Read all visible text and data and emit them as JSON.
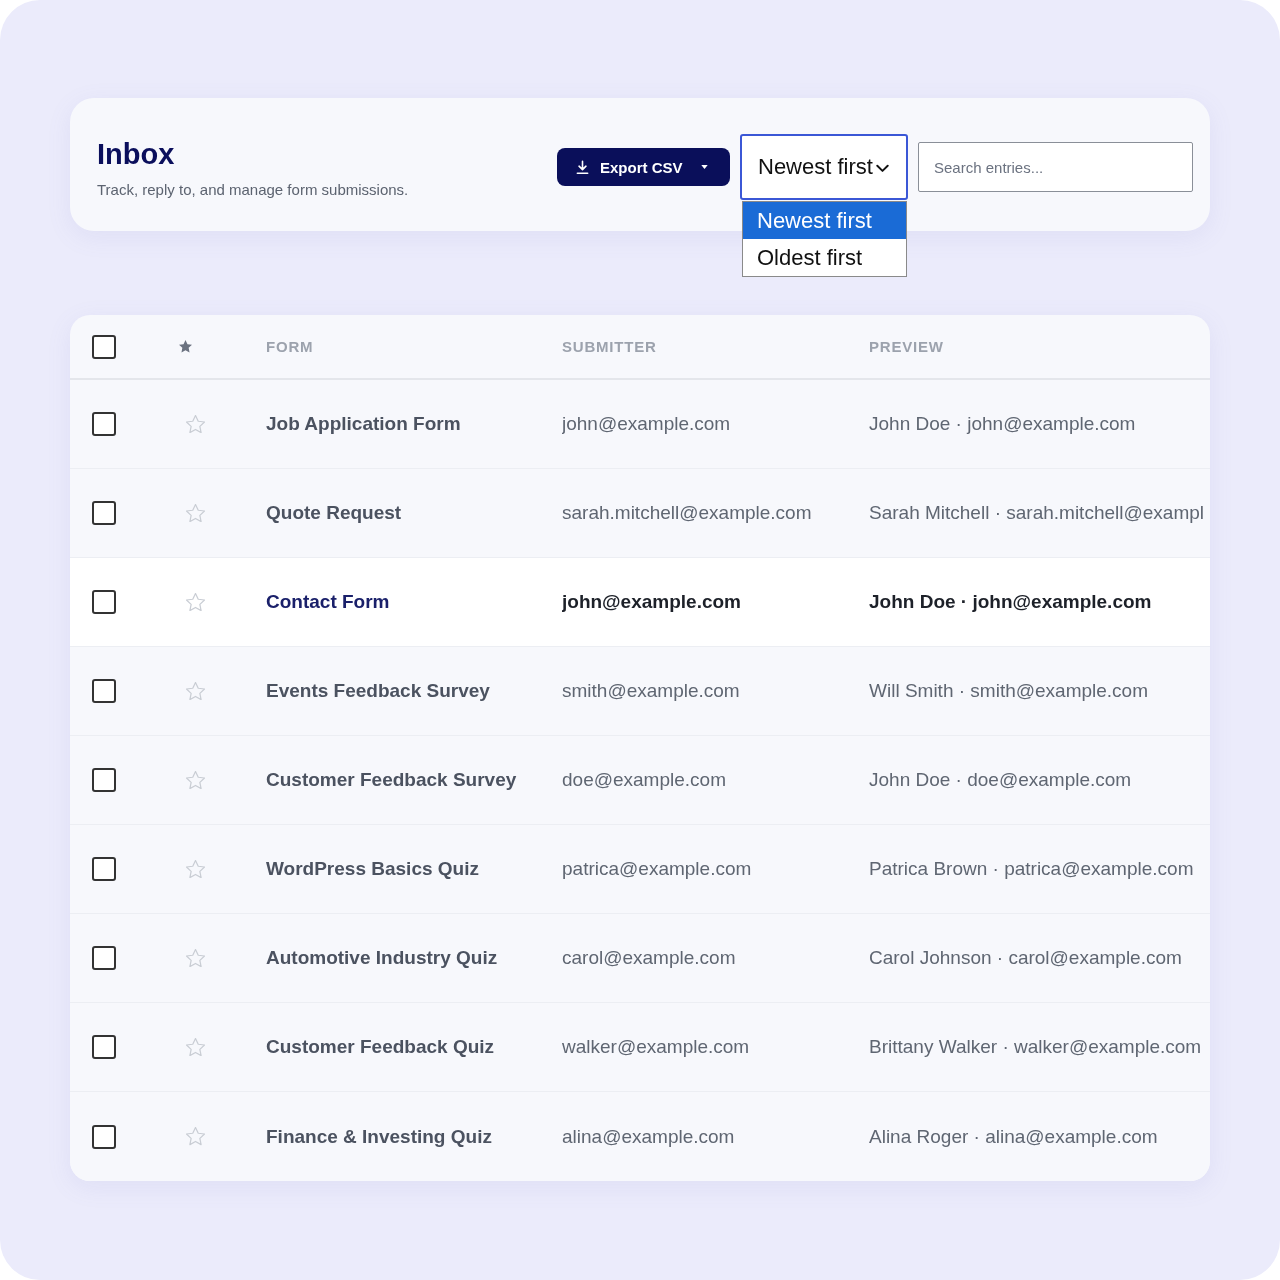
{
  "header": {
    "title": "Inbox",
    "subtitle": "Track, reply to, and manage form submissions."
  },
  "toolbar": {
    "export_button": {
      "label": "Export CSV"
    },
    "sort_select": {
      "value": "Newest first",
      "expanded": true,
      "options": [
        {
          "label": "Newest first",
          "selected": true
        },
        {
          "label": "Oldest first",
          "selected": false
        }
      ]
    },
    "search": {
      "placeholder": "Search entries..."
    }
  },
  "table": {
    "select_all": {
      "checked": false
    },
    "columns": [
      "FORM",
      "SUBMITTER",
      "PREVIEW"
    ],
    "rows": [
      {
        "form": "Job Application Form",
        "submitter": "john@example.com",
        "preview": "John Doe · john@example.com",
        "checked": false,
        "starred": false,
        "unread": false
      },
      {
        "form": "Quote Request",
        "submitter": "sarah.mitchell@example.com",
        "preview": "Sarah Mitchell · sarah.mitchell@exampl",
        "checked": false,
        "starred": false,
        "unread": false
      },
      {
        "form": "Contact Form",
        "submitter": "john@example.com",
        "preview": "John Doe · john@example.com",
        "checked": false,
        "starred": false,
        "unread": true
      },
      {
        "form": "Events Feedback Survey",
        "submitter": "smith@example.com",
        "preview": "Will Smith · smith@example.com",
        "checked": false,
        "starred": false,
        "unread": false
      },
      {
        "form": "Customer Feedback Survey",
        "submitter": "doe@example.com",
        "preview": "John Doe · doe@example.com",
        "checked": false,
        "starred": false,
        "unread": false
      },
      {
        "form": "WordPress Basics Quiz",
        "submitter": "patrica@example.com",
        "preview": "Patrica Brown · patrica@example.com",
        "checked": false,
        "starred": false,
        "unread": false
      },
      {
        "form": "Automotive Industry Quiz",
        "submitter": "carol@example.com",
        "preview": "Carol Johnson · carol@example.com",
        "checked": false,
        "starred": false,
        "unread": false
      },
      {
        "form": "Customer Feedback Quiz",
        "submitter": "walker@example.com",
        "preview": "Brittany Walker · walker@example.com",
        "checked": false,
        "starred": false,
        "unread": false
      },
      {
        "form": "Finance & Investing Quiz",
        "submitter": "alina@example.com",
        "preview": "Alina Roger · alina@example.com",
        "checked": false,
        "starred": false,
        "unread": false
      }
    ]
  }
}
